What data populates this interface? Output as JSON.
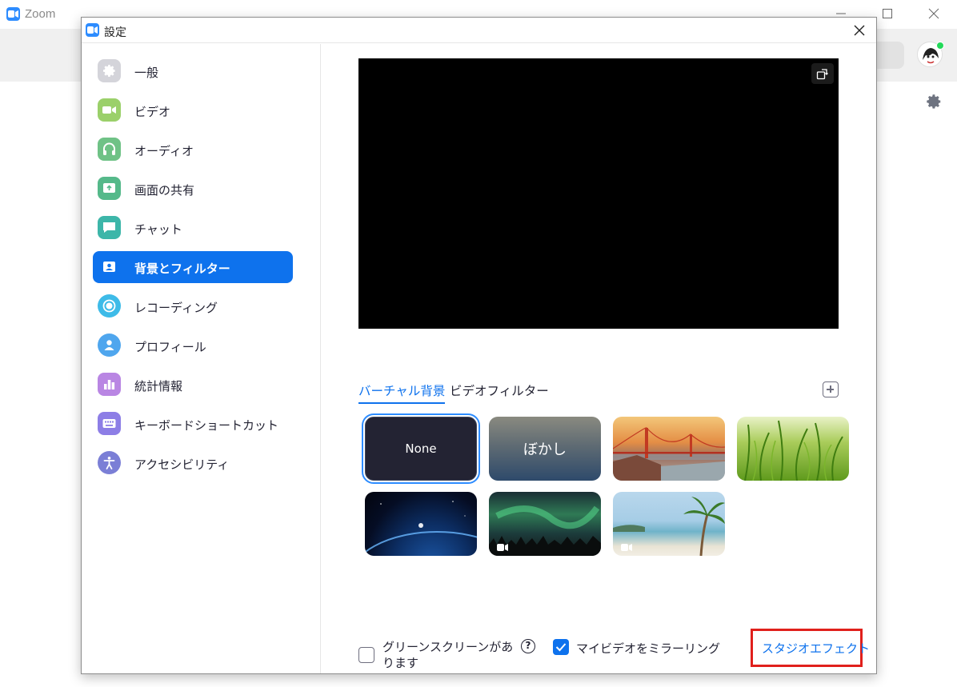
{
  "app": {
    "title": "Zoom"
  },
  "dialog": {
    "title": "設定"
  },
  "sidebar": {
    "items": [
      {
        "label": "一般",
        "icon": "gear-icon",
        "color": "#c8c8d0",
        "active": false
      },
      {
        "label": "ビデオ",
        "icon": "video-camera-icon",
        "color": "#9bd06a",
        "active": false
      },
      {
        "label": "オーディオ",
        "icon": "headphones-icon",
        "color": "#6fc286",
        "active": false
      },
      {
        "label": "画面の共有",
        "icon": "share-screen-icon",
        "color": "#55b98a",
        "active": false
      },
      {
        "label": "チャット",
        "icon": "chat-bubble-icon",
        "color": "#3db6a9",
        "active": false
      },
      {
        "label": "背景とフィルター",
        "icon": "background-icon",
        "color": "#0e72ed",
        "active": true
      },
      {
        "label": "レコーディング",
        "icon": "record-icon",
        "color": "#3ebbe8",
        "active": false
      },
      {
        "label": "プロフィール",
        "icon": "profile-icon",
        "color": "#4fa6ee",
        "active": false
      },
      {
        "label": "統計情報",
        "icon": "statistics-icon",
        "color": "#b986e3",
        "active": false
      },
      {
        "label": "キーボードショートカット",
        "icon": "keyboard-icon",
        "color": "#8d7ee6",
        "active": false
      },
      {
        "label": "アクセシビリティ",
        "icon": "accessibility-icon",
        "color": "#7b7fd6",
        "active": false
      }
    ]
  },
  "tabs": {
    "virtual": "バーチャル背景",
    "filter": "ビデオフィルター"
  },
  "backgrounds": {
    "none": "None",
    "blur": "ぼかし",
    "items": [
      "bridge-image",
      "grass-image",
      "earth-image",
      "aurora-video",
      "beach-video"
    ]
  },
  "options": {
    "green_screen": "グリーンスクリーンがあります",
    "green_screen_checked": false,
    "help": "?",
    "mirror": "マイビデオをミラーリング",
    "mirror_checked": true
  },
  "studio_effects": "スタジオエフェクト",
  "colors": {
    "accent": "#0e72ed",
    "highlight": "#e0201c"
  }
}
